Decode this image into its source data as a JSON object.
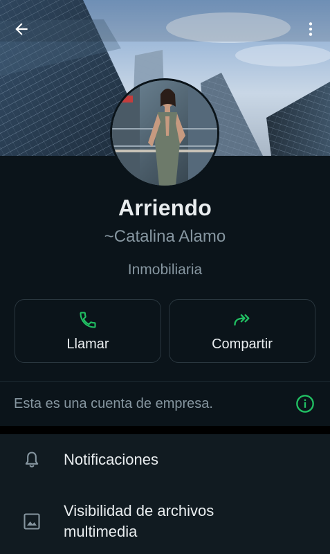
{
  "header": {
    "back_icon": "arrow-left-icon",
    "menu_icon": "more-vertical-icon"
  },
  "profile": {
    "name": "Arriendo",
    "push_name": "~Catalina Alamo",
    "category": "Inmobiliaria"
  },
  "actions": [
    {
      "label": "Llamar",
      "icon": "phone-icon"
    },
    {
      "label": "Compartir",
      "icon": "forward-icon"
    }
  ],
  "business_notice": {
    "text": "Esta es una cuenta de empresa.",
    "icon": "info-icon"
  },
  "settings": {
    "items": [
      {
        "label": "Notificaciones",
        "icon": "bell-icon"
      },
      {
        "label": "Visibilidad de archivos\nmultimedia",
        "icon": "image-icon"
      }
    ]
  },
  "colors": {
    "background": "#0b141a",
    "panel": "#111b21",
    "accent_green": "#21c063",
    "text_primary": "#e9edef",
    "text_secondary": "#8696a0"
  }
}
